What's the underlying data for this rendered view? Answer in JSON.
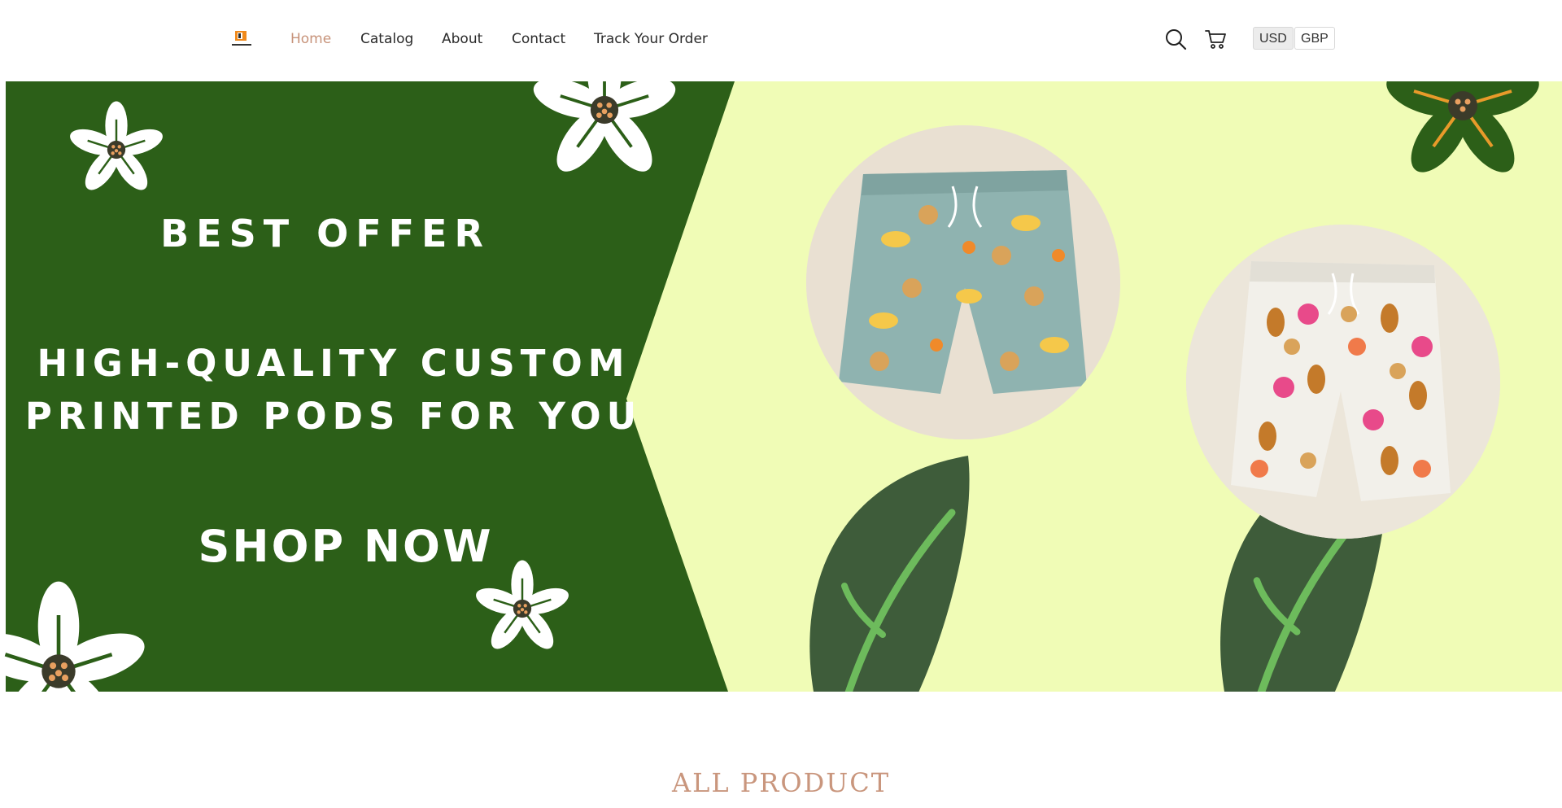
{
  "header": {
    "logo_name": "brand-logo",
    "nav": [
      {
        "label": "Home",
        "active": true
      },
      {
        "label": "Catalog",
        "active": false
      },
      {
        "label": "About",
        "active": false
      },
      {
        "label": "Contact",
        "active": false
      },
      {
        "label": "Track Your Order",
        "active": false
      }
    ],
    "icons": [
      "search-icon",
      "cart-icon"
    ],
    "currencies": [
      {
        "label": "USD",
        "active": true
      },
      {
        "label": "GBP",
        "active": false
      }
    ]
  },
  "hero": {
    "offer": "BEST OFFER",
    "headline_1": "HIGH-QUALITY CUSTOM",
    "headline_2": "PRINTED PODS FOR YOU",
    "cta": "SHOP NOW",
    "colors": {
      "panel": "#2c5f18",
      "background": "#f0fcb6",
      "leaf": "#3e5c3a",
      "leaf_vein": "#6dbb5c",
      "flower": "#ffffff",
      "flower_center": "#e8a060"
    }
  },
  "section": {
    "title": "ALL PRODUCT"
  }
}
